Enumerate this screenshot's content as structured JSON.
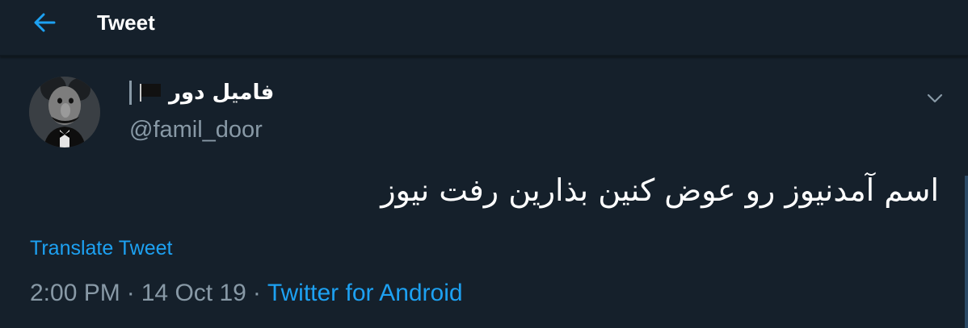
{
  "header": {
    "back_icon": "arrow-left-icon",
    "title": "Tweet"
  },
  "tweet": {
    "author": {
      "display_name": "فامیل دور",
      "flag_icon": "black-flag-icon",
      "handle": "@famil_door",
      "avatar_icon": "avatar-image"
    },
    "menu_icon": "chevron-down-icon",
    "text": "اسم آمدنیوز رو عوض کنین بذارین رفت نیوز",
    "translate_label": "Translate Tweet",
    "time": "2:00 PM",
    "separator": "·",
    "date": "14 Oct 19",
    "source": "Twitter for Android"
  },
  "colors": {
    "background": "#15202b",
    "accent": "#1da1f2",
    "secondary_text": "#8899a6",
    "primary_text": "#ffffff"
  }
}
